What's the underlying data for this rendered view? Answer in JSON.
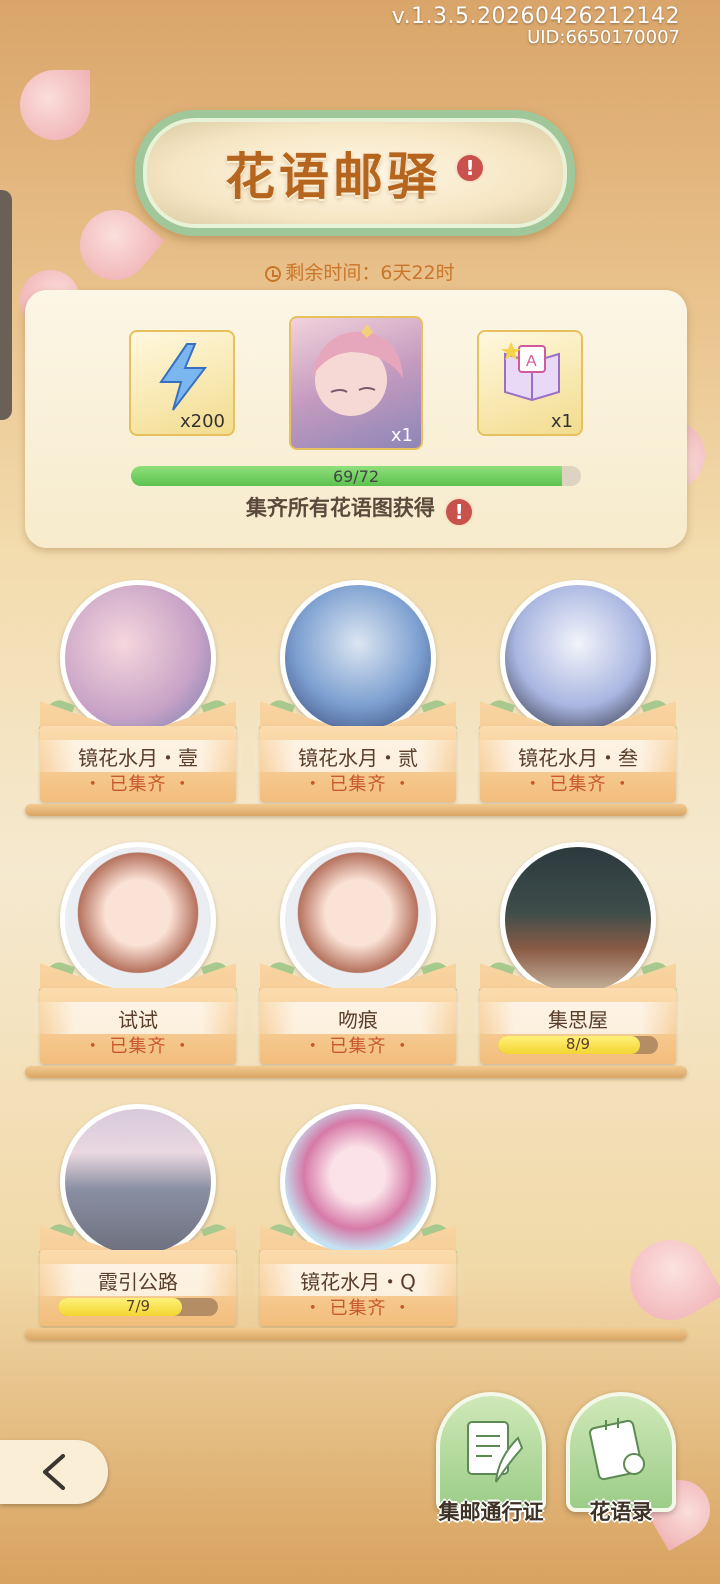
{
  "version": {
    "build": "v.1.3.5.20260426212142",
    "uid": "UID:6650170007"
  },
  "banner": {
    "title": "花语邮驿",
    "alert": "!"
  },
  "timer": {
    "text": "剩余时间：6天22时"
  },
  "rewards": {
    "items": [
      {
        "icon": "lightning-icon",
        "qty": "x200"
      },
      {
        "icon": "portrait-card",
        "qty": "x1"
      },
      {
        "icon": "book-icon",
        "qty": "x1"
      }
    ],
    "progress": {
      "current": 69,
      "total": 72,
      "text": "69/72"
    },
    "collect_text": "集齐所有花语图获得",
    "alert": "!"
  },
  "cards": [
    {
      "name": "镜花水月・壹",
      "status": "・ 已集齐 ・"
    },
    {
      "name": "镜花水月・贰",
      "status": "・ 已集齐 ・"
    },
    {
      "name": "镜花水月・叁",
      "status": "・ 已集齐 ・"
    },
    {
      "name": "试试",
      "status": "・ 已集齐 ・"
    },
    {
      "name": "吻痕",
      "status": "・ 已集齐 ・"
    },
    {
      "name": "集思屋",
      "progress": {
        "current": 8,
        "total": 9,
        "text": "8/9"
      }
    },
    {
      "name": "霞引公路",
      "progress": {
        "current": 7,
        "total": 9,
        "text": "7/9"
      }
    },
    {
      "name": "镜花水月・Q",
      "status": "・ 已集齐 ・"
    }
  ],
  "bottom": {
    "pass_label": "集邮通行证",
    "records_label": "花语录"
  },
  "colors": {
    "accent": "#c9572c",
    "banner_text": "#b5651d",
    "progress_green": "#5cc24f",
    "progress_yellow": "#f3d532"
  }
}
